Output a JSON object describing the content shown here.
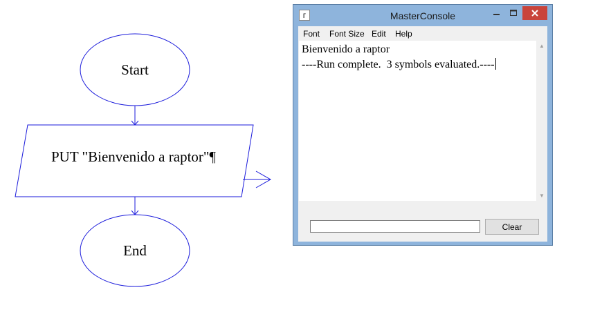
{
  "flowchart": {
    "start_label": "Start",
    "output_statement": "PUT \"Bienvenido a raptor\"¶",
    "end_label": "End",
    "line_color": "#1a1adb"
  },
  "console": {
    "title": "MasterConsole",
    "icon": "raptor-icon",
    "menu": [
      "Font",
      "Font Size",
      "Edit",
      "Help"
    ],
    "output_lines": [
      "Bienvenido a raptor",
      "----Run complete.  3 symbols evaluated.----"
    ],
    "input_value": "",
    "clear_label": "Clear",
    "close_color": "#c9443b"
  }
}
